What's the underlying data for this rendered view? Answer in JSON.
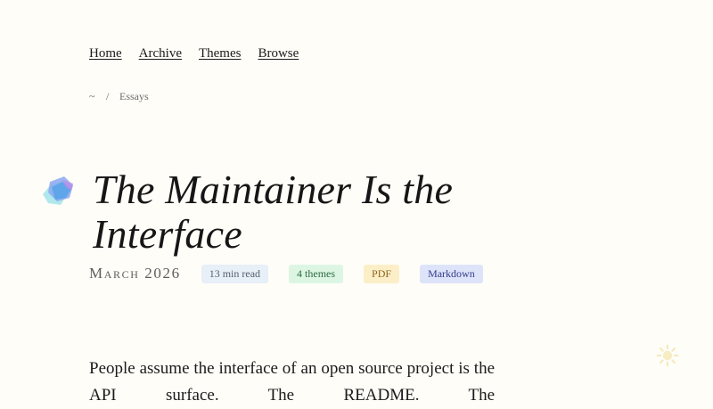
{
  "nav": {
    "items": [
      {
        "label": "Home"
      },
      {
        "label": "Archive"
      },
      {
        "label": "Themes"
      },
      {
        "label": "Browse"
      }
    ]
  },
  "breadcrumb": {
    "home": "~",
    "separator": "/",
    "current": "Essays"
  },
  "article": {
    "title": "The Maintainer Is the Interface",
    "date": "March 2026",
    "read_time": "13 min read",
    "themes": "4 themes",
    "pdf": "PDF",
    "markdown": "Markdown",
    "body_line1": "People assume the interface of an open source project",
    "body_line2": "is the API surface. The README. The"
  },
  "icons": {
    "logo": "crystal-logo-icon",
    "theme_toggle": "sun-icon"
  },
  "colors": {
    "background": "#fefdf8",
    "text": "#1b1b1b",
    "tag_read_bg": "#e7eff7",
    "tag_themes_bg": "#ddf6e3",
    "tag_pdf_bg": "#fcefc7",
    "tag_markdown_bg": "#dde4f9"
  }
}
